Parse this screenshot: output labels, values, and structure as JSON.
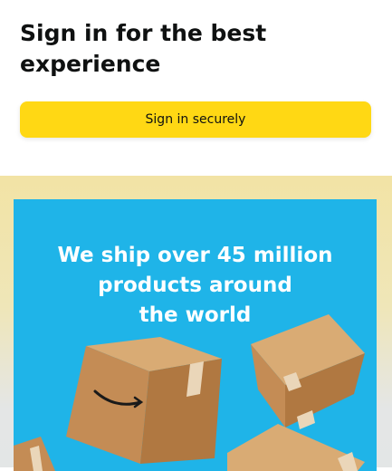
{
  "signin": {
    "title": "Sign in for the best experience",
    "button_label": "Sign in securely"
  },
  "promo": {
    "lines": [
      "We ship over 45 million",
      "products around",
      "the world"
    ],
    "image_icon": "shipping-boxes-illustration"
  },
  "colors": {
    "button": "#ffd814",
    "banner": "#1fb4e8",
    "box": "#c8955f",
    "tape": "#e6cfb0"
  }
}
